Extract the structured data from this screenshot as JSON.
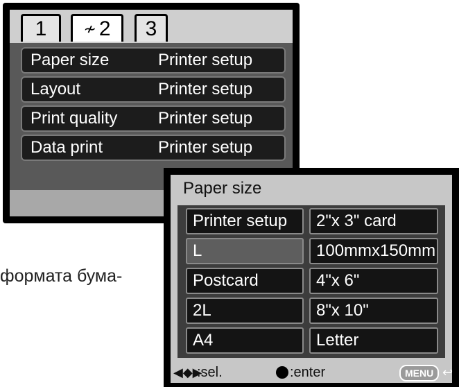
{
  "setup_menu": {
    "tabs": [
      {
        "label": "1"
      },
      {
        "label": "2",
        "icon": "print-icon"
      },
      {
        "label": "3"
      }
    ],
    "rows": [
      {
        "label": "Paper size",
        "value": "Printer setup"
      },
      {
        "label": "Layout",
        "value": "Printer setup"
      },
      {
        "label": "Print quality",
        "value": "Printer setup"
      },
      {
        "label": "Data print",
        "value": "Printer setup"
      }
    ]
  },
  "caption": "формата бума-",
  "paper_size_menu": {
    "title": "Paper size",
    "left_options": [
      "Printer setup",
      "L",
      "Postcard",
      "2L",
      "A4"
    ],
    "right_options": [
      "2\"x 3\" card",
      "100mmx150mm",
      "4\"x 6\"",
      "8\"x 10\"",
      "Letter"
    ],
    "highlighted": "L"
  },
  "footer": {
    "select_label": ":sel.",
    "enter_label": ":enter",
    "menu_label": "MENU"
  }
}
